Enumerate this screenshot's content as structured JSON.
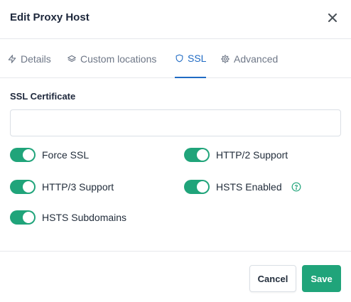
{
  "modal": {
    "title": "Edit Proxy Host"
  },
  "tabs": [
    {
      "label": "Details",
      "icon": "lightning-icon"
    },
    {
      "label": "Custom locations",
      "icon": "layers-icon"
    },
    {
      "label": "SSL",
      "icon": "shield-icon",
      "active": true
    },
    {
      "label": "Advanced",
      "icon": "gear-icon"
    }
  ],
  "ssl": {
    "certificate_label": "SSL Certificate",
    "certificate_value": ""
  },
  "toggles": [
    {
      "label": "Force SSL",
      "enabled": true
    },
    {
      "label": "HTTP/2 Support",
      "enabled": true
    },
    {
      "label": "HTTP/3 Support",
      "enabled": true
    },
    {
      "label": "HSTS Enabled",
      "enabled": true
    },
    {
      "label": "HSTS Subdomains",
      "enabled": true
    }
  ],
  "footer": {
    "cancel_label": "Cancel",
    "save_label": "Save"
  },
  "colors": {
    "accent": "#206bc4",
    "toggle_on": "#20a47a",
    "save_button": "#20a47a"
  }
}
